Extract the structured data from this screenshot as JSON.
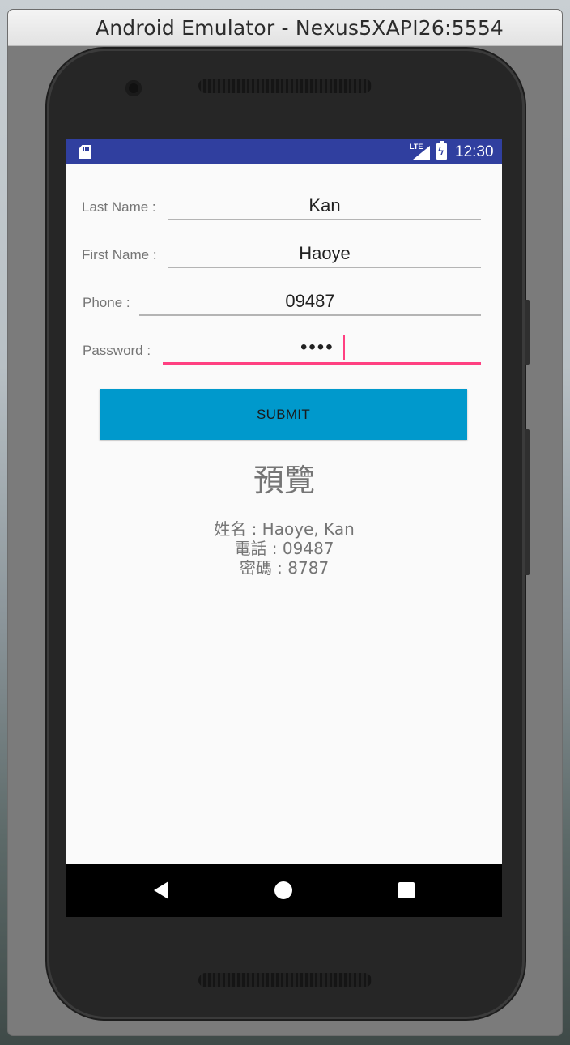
{
  "window": {
    "title": "Android Emulator - Nexus5XAPI26:5554"
  },
  "statusbar": {
    "network_label": "LTE",
    "time": "12:30",
    "color": "#303f9f"
  },
  "form": {
    "last_name": {
      "label": "Last Name :",
      "value": "Kan"
    },
    "first_name": {
      "label": "First Name :",
      "value": "Haoye"
    },
    "phone": {
      "label": "Phone :",
      "value": "09487"
    },
    "password": {
      "label": "Password :",
      "masked_value": "••••"
    },
    "submit_label": "SUBMIT"
  },
  "preview": {
    "title": "預覽",
    "name_line": "姓名 : Haoye, Kan",
    "phone_line": "電話 : 09487",
    "password_line": "密碼 : 8787"
  },
  "navbar": {
    "icons": [
      "back-icon",
      "home-icon",
      "recents-icon"
    ]
  },
  "colors": {
    "accent": "#ff4081",
    "button": "#0099cc",
    "background": "#fafafa"
  }
}
